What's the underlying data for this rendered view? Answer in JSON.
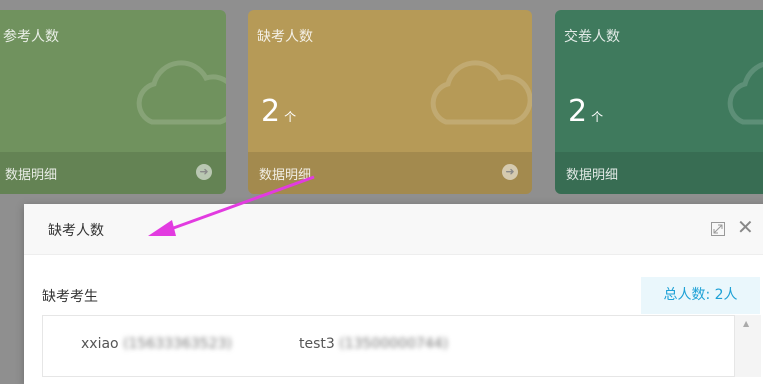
{
  "cards": [
    {
      "title": "参考人数",
      "link": "数据明细"
    },
    {
      "title": "缺考人数",
      "count": "2",
      "unit": "个",
      "link": "数据明细"
    },
    {
      "title": "交卷人数",
      "count": "2",
      "unit": "个",
      "link": "数据明细"
    }
  ],
  "modal": {
    "title": "缺考人数",
    "section_title": "缺考考生",
    "total": "总人数: 2人",
    "students": [
      {
        "name": "xxiao",
        "phone": "(15633363523)"
      },
      {
        "name": "test3",
        "phone": "(13500000744)"
      }
    ]
  },
  "colors": {
    "card_green": "#70925e",
    "card_yellow": "#b69a57",
    "card_dark_green": "#3f7a5d",
    "accent_blue": "#1ea1d6",
    "annotation_arrow": "#e23be0"
  }
}
